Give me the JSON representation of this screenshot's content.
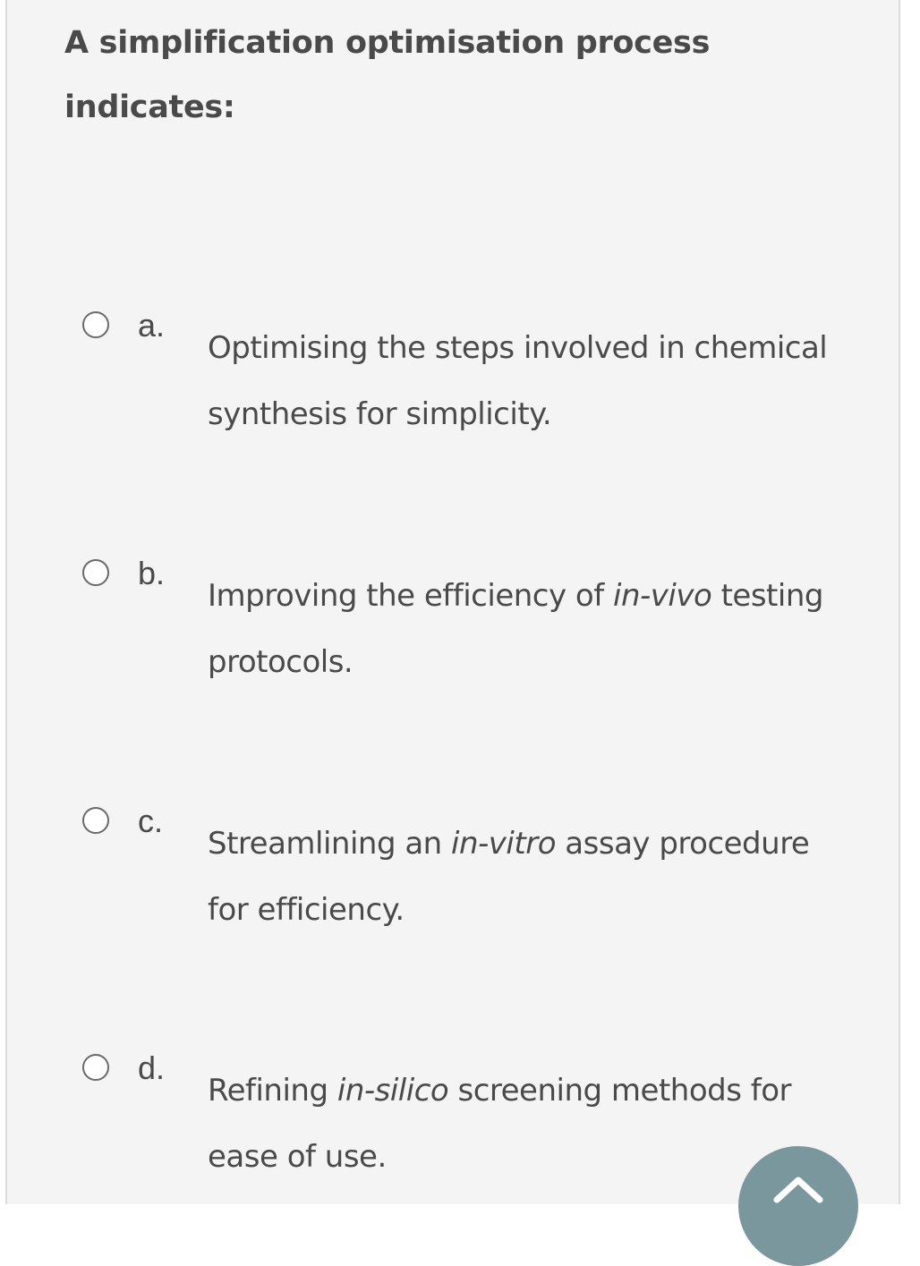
{
  "question": {
    "text": "A simplification optimisation process indicates:"
  },
  "options": [
    {
      "letter": "a.",
      "parts": [
        {
          "text": "Optimising the steps involved in chemical synthesis for simplicity.",
          "italic": false
        }
      ]
    },
    {
      "letter": "b.",
      "parts": [
        {
          "text": "Improving the efficiency of ",
          "italic": false
        },
        {
          "text": "in-vivo",
          "italic": true
        },
        {
          "text": " testing protocols.",
          "italic": false
        }
      ]
    },
    {
      "letter": "c.",
      "parts": [
        {
          "text": "Streamlining an ",
          "italic": false
        },
        {
          "text": "in-vitro",
          "italic": true
        },
        {
          "text": " assay procedure for efficiency.",
          "italic": false
        }
      ]
    },
    {
      "letter": "d.",
      "parts": [
        {
          "text": "Refining ",
          "italic": false
        },
        {
          "text": "in-silico",
          "italic": true
        },
        {
          "text": " screening methods for ease of use.",
          "italic": false
        }
      ]
    }
  ],
  "scroll_top_button": {
    "icon": "chevron-up-icon",
    "color": "#7b979e"
  },
  "colors": {
    "panel_background": "#f4f4f4",
    "text": "#4a4a4a",
    "radio_border": "#6a6a6a"
  }
}
